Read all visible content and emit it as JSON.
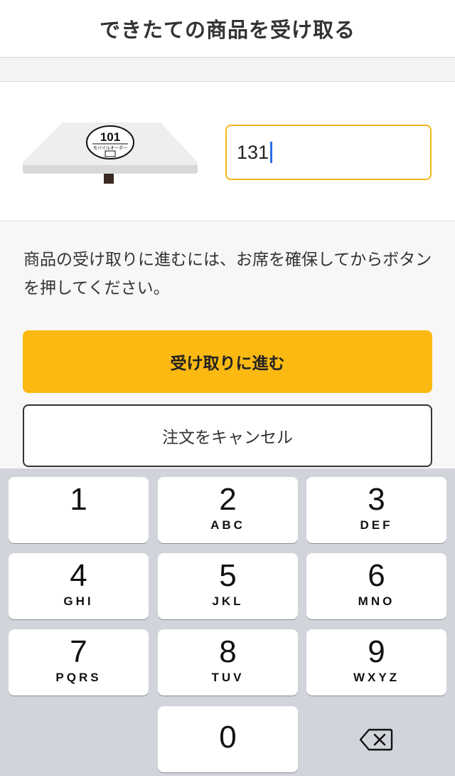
{
  "header": {
    "title": "できたての商品を受け取る"
  },
  "seat": {
    "table_label_number": "101",
    "table_label_text": "モバイルオーダー",
    "input_value": "131"
  },
  "instructions": "商品の受け取りに進むには、お席を確保してからボタンを押してください。",
  "buttons": {
    "proceed_label": "受け取りに進む",
    "cancel_label": "注文をキャンセル"
  },
  "keypad": {
    "keys": [
      {
        "digit": "1",
        "letters": ""
      },
      {
        "digit": "2",
        "letters": "ABC"
      },
      {
        "digit": "3",
        "letters": "DEF"
      },
      {
        "digit": "4",
        "letters": "GHI"
      },
      {
        "digit": "5",
        "letters": "JKL"
      },
      {
        "digit": "6",
        "letters": "MNO"
      },
      {
        "digit": "7",
        "letters": "PQRS"
      },
      {
        "digit": "8",
        "letters": "TUV"
      },
      {
        "digit": "9",
        "letters": "WXYZ"
      },
      {
        "digit": "0",
        "letters": ""
      }
    ],
    "delete_icon": "backspace-icon"
  },
  "colors": {
    "accent": "#fbb912",
    "input_border": "#f2b51a",
    "caret": "#2f6de3",
    "keyboard_bg": "#d1d4da"
  }
}
